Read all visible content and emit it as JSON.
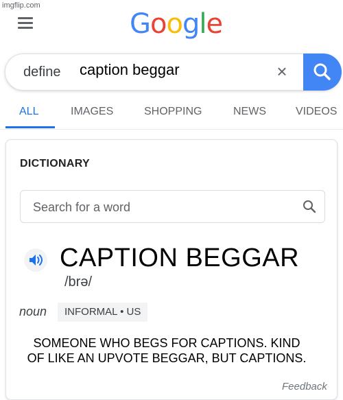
{
  "watermark": "imgflip.com",
  "logo": {
    "letters": [
      "G",
      "o",
      "o",
      "g",
      "l",
      "e"
    ],
    "colors": [
      "#4285f4",
      "#ea4335",
      "#fbbc05",
      "#4285f4",
      "#34a853",
      "#ea4335"
    ]
  },
  "search": {
    "prefix": "define",
    "value": "caption beggar",
    "clear_glyph": "×"
  },
  "tabs": [
    {
      "label": "ALL",
      "active": true
    },
    {
      "label": "IMAGES",
      "active": false
    },
    {
      "label": "SHOPPING",
      "active": false
    },
    {
      "label": "NEWS",
      "active": false
    },
    {
      "label": "VIDEOS",
      "active": false
    }
  ],
  "dictionary": {
    "title": "DICTIONARY",
    "search_placeholder": "Search for a word",
    "headword": "CAPTION BEGGAR",
    "phonetic": "/brə/",
    "part_of_speech": "noun",
    "register": "INFORMAL • US",
    "definition_line1": "SOMEONE WHO BEGS FOR CAPTIONS. KIND",
    "definition_line2": "OF LIKE AN UPVOTE BEGGAR, BUT CAPTIONS.",
    "feedback": "Feedback"
  },
  "icons": {
    "menu": "hamburger-menu-icon",
    "clear": "close-icon",
    "search": "search-icon",
    "speaker": "speaker-icon"
  },
  "colors": {
    "accent": "#1a73e8",
    "search_button": "#4285f4",
    "speaker": "#1a73e8"
  }
}
